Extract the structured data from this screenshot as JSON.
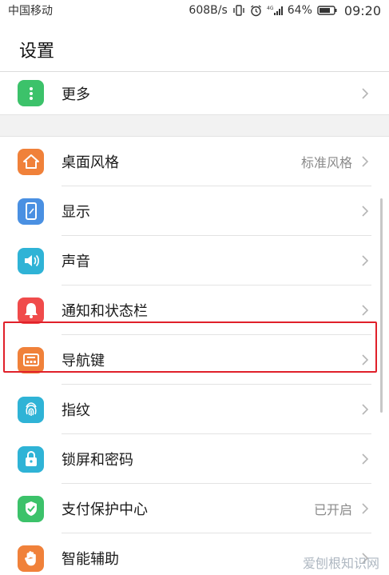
{
  "status_bar": {
    "carrier": "中国移动",
    "speed": "608B/s",
    "network": "4G",
    "battery": "64%",
    "time": "09:20"
  },
  "header": {
    "title": "设置"
  },
  "groups": [
    {
      "items": [
        {
          "label": "更多",
          "value": "",
          "icon": "more-icon",
          "color": "#3cc26a"
        }
      ]
    },
    {
      "items": [
        {
          "label": "桌面风格",
          "value": "标准风格",
          "icon": "home-icon",
          "color": "#f0813a"
        },
        {
          "label": "显示",
          "value": "",
          "icon": "display-icon",
          "color": "#4a90e2"
        },
        {
          "label": "声音",
          "value": "",
          "icon": "sound-icon",
          "color": "#2fb3d6"
        },
        {
          "label": "通知和状态栏",
          "value": "",
          "icon": "bell-icon",
          "color": "#f04b4b"
        },
        {
          "label": "导航键",
          "value": "",
          "icon": "navigation-icon",
          "color": "#f0813a"
        },
        {
          "label": "指纹",
          "value": "",
          "icon": "fingerprint-icon",
          "color": "#2fb3d6"
        },
        {
          "label": "锁屏和密码",
          "value": "",
          "icon": "lock-icon",
          "color": "#2fb3d6"
        },
        {
          "label": "支付保护中心",
          "value": "已开启",
          "icon": "shield-icon",
          "color": "#3cc26a"
        },
        {
          "label": "智能辅助",
          "value": "",
          "icon": "hand-icon",
          "color": "#f0813a"
        }
      ]
    }
  ],
  "watermark": "爱刨根知识网"
}
